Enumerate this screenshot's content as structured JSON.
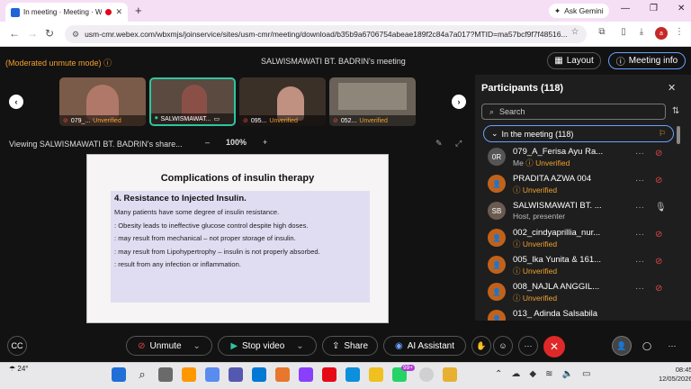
{
  "browser": {
    "tab_title": "In meeting · Meeting · Webex",
    "url": "usm-cmr.webex.com/wbxmjs/joinservice/sites/usm-cmr/meeting/download/b35b9a6706754abeae189f2c84a7a017?MTID=ma57bcf9f7f48516...",
    "gemini": "Ask Gemini",
    "profile_initial": "a"
  },
  "meeting": {
    "moderated": "(Moderated unmute mode)",
    "title": "SALWISMAWATI BT. BADRIN's meeting",
    "layout_label": "Layout",
    "info_label": "Meeting info",
    "viewing": "Viewing SALWISMAWATI BT. BADRIN's share...",
    "zoom": "100%",
    "zoom_minus": "–",
    "zoom_plus": "+"
  },
  "thumbnails": [
    {
      "name": "079_...",
      "status": "Unverified"
    },
    {
      "name": "SALWISMAWAT...",
      "status": ""
    },
    {
      "name": "095...",
      "status": "Unverified"
    },
    {
      "name": "052...",
      "status": "Unverified"
    }
  ],
  "slide": {
    "title": "Complications of insulin therapy",
    "heading": "4. Resistance to Injected Insulin.",
    "lines": [
      "Many patients have some degree of insulin resistance.",
      ": Obesity leads to ineffective glucose control despite high doses.",
      ": may result from mechanical – not proper storage of insulin.",
      ": may result from Lipohypertrophy – insulin is not properly absorbed.",
      ": result from any infection or inflammation."
    ]
  },
  "participants": {
    "title": "Participants (118)",
    "search_placeholder": "Search",
    "in_meeting": "In the meeting (118)",
    "list": [
      {
        "initials": "0R",
        "name": "079_A_Ferisa Ayu Ra...",
        "sub1": "Me",
        "sub2": "Unverified",
        "color": "#555555"
      },
      {
        "initials": "",
        "name": "PRADITA AZWA 004",
        "sub1": "",
        "sub2": "Unverified",
        "color": "#c0621c"
      },
      {
        "initials": "SB",
        "name": "SALWISMAWATI BT. ...",
        "sub1": "Host, presenter",
        "sub2": "",
        "color": "#6a5a50"
      },
      {
        "initials": "",
        "name": "002_cindyaprillia_nur...",
        "sub1": "",
        "sub2": "Unverified",
        "color": "#c0621c"
      },
      {
        "initials": "",
        "name": "005_Ika Yunita & 161...",
        "sub1": "",
        "sub2": "Unverified",
        "color": "#c0621c"
      },
      {
        "initials": "",
        "name": "008_NAJLA ANGGIL...",
        "sub1": "",
        "sub2": "Unverified",
        "color": "#c0621c"
      },
      {
        "initials": "",
        "name": "013_ Adinda Salsabila",
        "sub1": "",
        "sub2": "",
        "color": "#c0621c"
      }
    ]
  },
  "controls": {
    "unmute": "Unmute",
    "stop_video": "Stop video",
    "share": "Share",
    "ai": "AI Assistant"
  },
  "taskbar": {
    "temp": "24°",
    "time": "08:45",
    "date": "12/05/2026",
    "badge": "99+"
  }
}
